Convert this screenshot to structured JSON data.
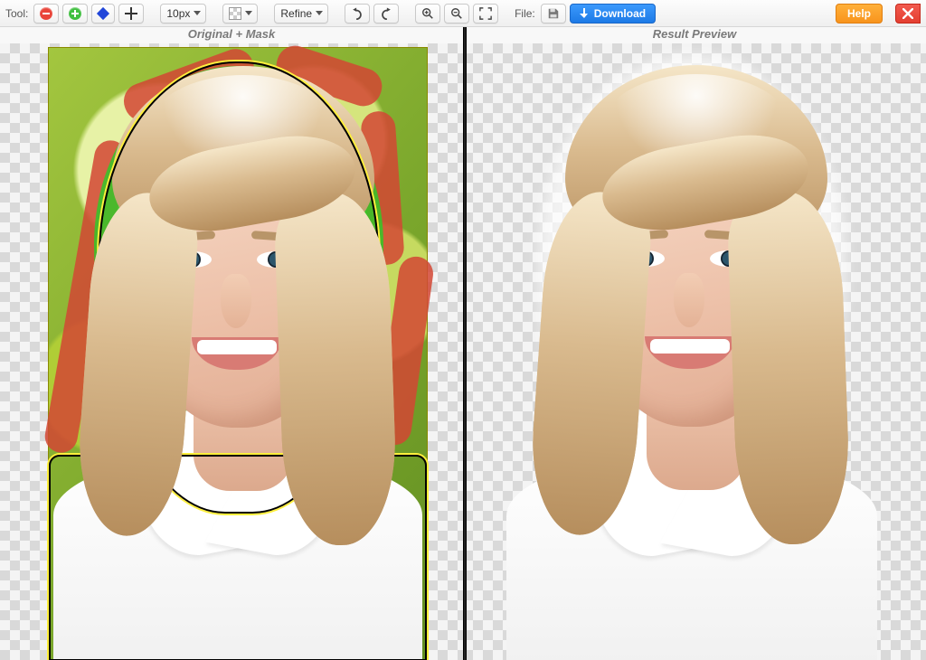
{
  "toolbar": {
    "tool_label": "Tool:",
    "brush_size": "10px",
    "refine_label": "Refine",
    "file_label": "File:",
    "download_label": "Download",
    "help_label": "Help"
  },
  "panes": {
    "left_title": "Original + Mask",
    "right_title": "Result Preview"
  },
  "icons": {
    "erase": "erase (red minus)",
    "keep": "keep (green plus)",
    "hair": "hair tool (blue diamond)",
    "pan": "pan (move cross)",
    "bgcolor": "background color (transparent)",
    "undo": "undo",
    "redo": "redo",
    "zoom_in": "zoom in",
    "zoom_out": "zoom out",
    "fit": "fit to screen",
    "save": "save",
    "close": "close"
  },
  "colors": {
    "accent_blue": "#1d7ae6",
    "accent_orange": "#f8941d",
    "accent_red": "#e43f31",
    "mask_keep": "#34c924",
    "mask_erase": "#d24634",
    "selection_outline": "#ffef3c"
  }
}
